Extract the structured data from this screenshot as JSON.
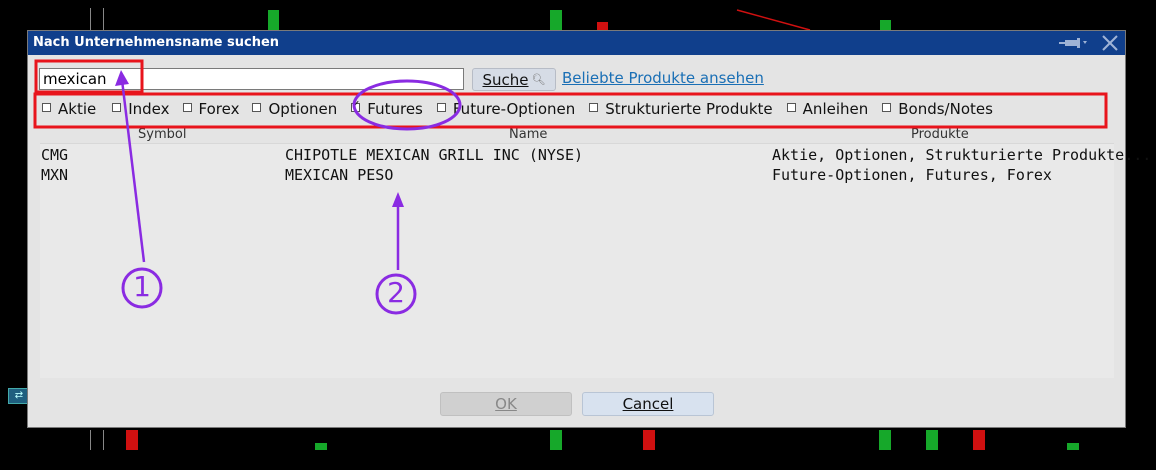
{
  "dialog": {
    "title": "Nach Unternehmensname suchen",
    "search_value": "mexican",
    "search_button": "Suche",
    "popular_link": "Beliebte Produkte ansehen",
    "filters": [
      {
        "label": "Aktie",
        "checked": false
      },
      {
        "label": "Index",
        "checked": false
      },
      {
        "label": "Forex",
        "checked": false
      },
      {
        "label": "Optionen",
        "checked": false
      },
      {
        "label": "Futures",
        "checked": true
      },
      {
        "label": "Future-Optionen",
        "checked": false
      },
      {
        "label": "Strukturierte Produkte",
        "checked": false
      },
      {
        "label": "Anleihen",
        "checked": false
      },
      {
        "label": "Bonds/Notes",
        "checked": false
      }
    ],
    "columns": {
      "symbol": "Symbol",
      "name": "Name",
      "products": "Produkte"
    },
    "rows": [
      {
        "symbol": "CMG",
        "name": "CHIPOTLE MEXICAN GRILL INC (NYSE)",
        "products": "Aktie, Optionen, Strukturierte Produkte..."
      },
      {
        "symbol": "MXN",
        "name": "MEXICAN PESO",
        "products": "Future-Optionen, Futures, Forex"
      }
    ],
    "ok_button": "OK",
    "cancel_button": "Cancel"
  },
  "annotations": {
    "marker_1": "1",
    "marker_2": "2",
    "color": "#8a2be2",
    "box_color": "#e8141c"
  },
  "colors": {
    "titlebar": "#103f8c",
    "candle_up": "#16a82a",
    "candle_down": "#d01010",
    "link": "#1a6fb5"
  }
}
